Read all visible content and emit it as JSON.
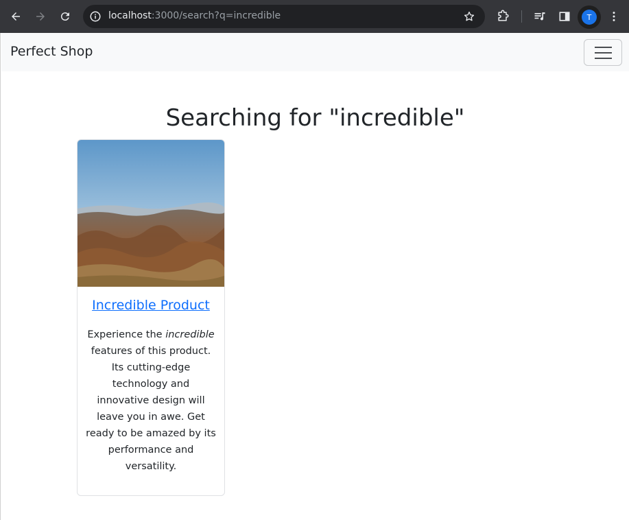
{
  "browser": {
    "url_host": "localhost",
    "url_rest": ":3000/search?q=incredible",
    "avatar_initial": "T",
    "icons": [
      "back-arrow-icon",
      "forward-arrow-icon",
      "reload-icon",
      "site-info-icon",
      "bookmark-star-icon",
      "extensions-icon",
      "media-queue-icon",
      "side-panel-icon",
      "profile-avatar",
      "kebab-menu-icon"
    ]
  },
  "navbar": {
    "brand": "Perfect Shop",
    "toggler_icon": "hamburger-menu-icon"
  },
  "search": {
    "heading": "Searching for \"incredible\""
  },
  "results": [
    {
      "title": "Incredible Product",
      "description_pre": "Experience the ",
      "description_em": "incredible",
      "description_post": " features of this product. Its cutting-edge technology and innovative design will leave you in awe. Get ready to be amazed by its performance and versatility.",
      "image": "landscape-hills-photo"
    }
  ],
  "colors": {
    "chrome_bg": "#35363a",
    "omnibox_bg": "#202124",
    "navbar_bg": "#f8f9fa",
    "link": "#0d6efd",
    "text": "#212529"
  }
}
